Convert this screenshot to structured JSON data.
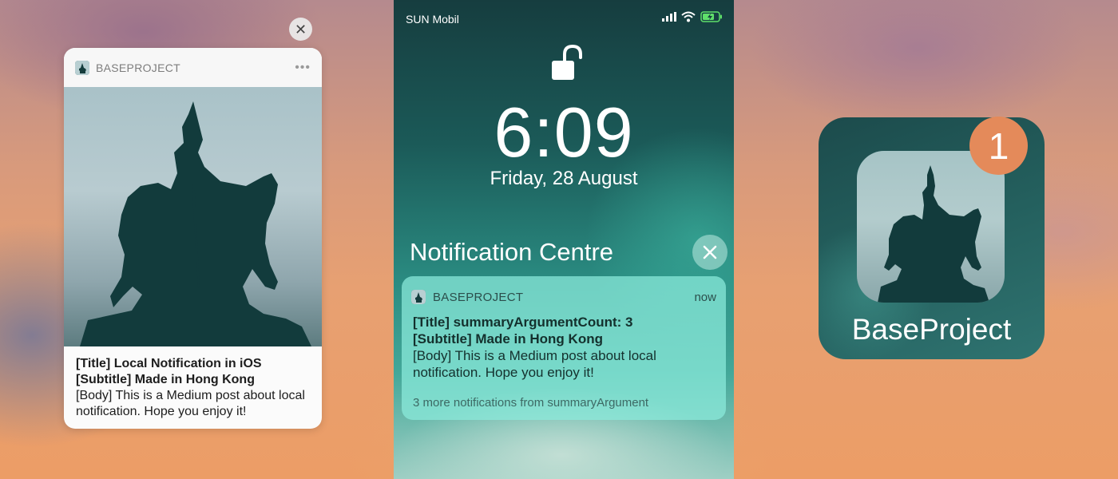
{
  "left_notification": {
    "close_glyph": "✕",
    "app_name": "BASEPROJECT",
    "more_glyph": "•••",
    "title": "[Title] Local Notification in iOS",
    "subtitle": "[Subtitle] Made in Hong Kong",
    "body": "[Body] This is a Medium post about local notification. Hope you enjoy it!"
  },
  "lock_screen": {
    "carrier": "SUN Mobil",
    "time": "6:09",
    "date": "Friday, 28 August",
    "notification_centre_title": "Notification Centre",
    "notification": {
      "app_name": "BASEPROJECT",
      "timestamp": "now",
      "title": "[Title] summaryArgumentCount: 3",
      "subtitle": "[Subtitle] Made in Hong Kong",
      "body": "[Body] This is a Medium post about local notification. Hope you enjoy it!",
      "more": "3 more notifications from summaryArgument"
    }
  },
  "app_icon": {
    "label": "BaseProject",
    "badge_count": "1"
  },
  "colors": {
    "badge": "#e48a5a",
    "accent_teal": "#2e6f6e"
  }
}
